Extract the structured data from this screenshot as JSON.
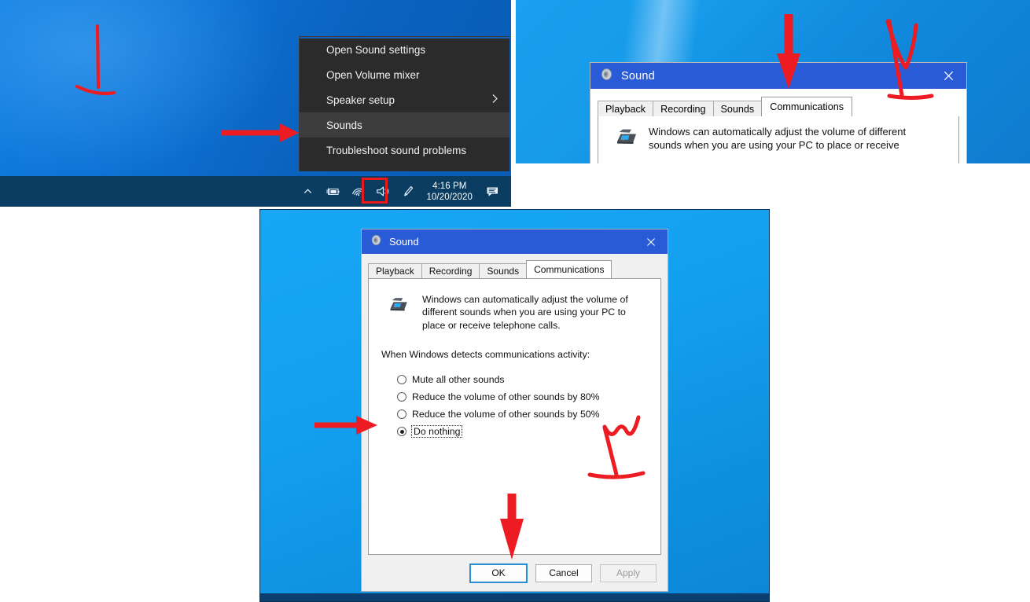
{
  "panels": {
    "tray_menu": {
      "name": "Windows taskbar volume context menu",
      "menu_items": [
        {
          "label": "Open Sound settings",
          "selected": false,
          "submenu": false
        },
        {
          "label": "Open Volume mixer",
          "selected": false,
          "submenu": false
        },
        {
          "label": "Speaker setup",
          "selected": false,
          "submenu": true,
          "submenu_icon": "chevron-right-icon"
        },
        {
          "label": "Sounds",
          "selected": true,
          "submenu": false
        },
        {
          "label": "Troubleshoot sound problems",
          "selected": false,
          "submenu": false
        }
      ],
      "taskbar": {
        "show_hidden_icons": "chevron-up-icon",
        "battery_icon": "battery-charging-icon",
        "network_icon": "wifi-icon",
        "volume_icon": "speaker-volume-icon",
        "pen_icon": "pen-workspace-icon",
        "time": "4:16 PM",
        "date": "10/20/2020",
        "action_center_icon": "action-center-icon"
      },
      "annotations": [
        {
          "type": "pointer-stroke",
          "target": "desktop"
        },
        {
          "type": "arrow-right",
          "target": "Sounds menu item"
        },
        {
          "type": "highlight-box",
          "target": "volume tray icon",
          "color": "#e8191a"
        }
      ]
    },
    "sound_dialog_top": {
      "title": "Sound",
      "title_icon": "sound-speaker-icon",
      "close_icon": "close-icon",
      "tabs": [
        "Playback",
        "Recording",
        "Sounds",
        "Communications"
      ],
      "active_tab": "Communications",
      "description": "Windows can automatically adjust the volume of different sounds when you are using your PC to place or receive",
      "annotations": [
        {
          "type": "arrow-down",
          "target": "Communications tab"
        },
        {
          "type": "check-scribble",
          "target": "title bar"
        }
      ]
    },
    "sound_dialog_main": {
      "title": "Sound",
      "title_icon": "sound-speaker-icon",
      "close_icon": "close-icon",
      "tabs": [
        {
          "label": "Playback",
          "active": false
        },
        {
          "label": "Recording",
          "active": false
        },
        {
          "label": "Sounds",
          "active": false
        },
        {
          "label": "Communications",
          "active": true
        }
      ],
      "description": "Windows can automatically adjust the volume of different sounds when you are using your PC to place or receive telephone calls.",
      "description_icon": "telephone-icon",
      "group_label": "When Windows detects communications activity:",
      "options": [
        {
          "label": "Mute all other sounds",
          "selected": false,
          "focused": false
        },
        {
          "label": "Reduce the volume of other sounds by 80%",
          "selected": false,
          "focused": false
        },
        {
          "label": "Reduce the volume of other sounds by 50%",
          "selected": false,
          "focused": false
        },
        {
          "label": "Do nothing",
          "selected": true,
          "focused": true
        }
      ],
      "buttons": [
        {
          "label": "OK",
          "style": "default",
          "enabled": true
        },
        {
          "label": "Cancel",
          "style": "normal",
          "enabled": true
        },
        {
          "label": "Apply",
          "style": "disabled",
          "enabled": false
        }
      ],
      "annotations": [
        {
          "type": "arrow-right",
          "target": "Do nothing radio button"
        },
        {
          "type": "w-scribble",
          "target": "empty dialog area"
        },
        {
          "type": "arrow-down",
          "target": "OK button"
        }
      ]
    }
  },
  "colors": {
    "annotation_red": "#e8191a",
    "titlebar_blue": "#2a5bd7",
    "desktop_blue": "#0fa0f0",
    "taskbar_navy": "#0b3c61",
    "menu_dark": "#2b2b2b",
    "focus_blue": "#2a8fd0"
  }
}
